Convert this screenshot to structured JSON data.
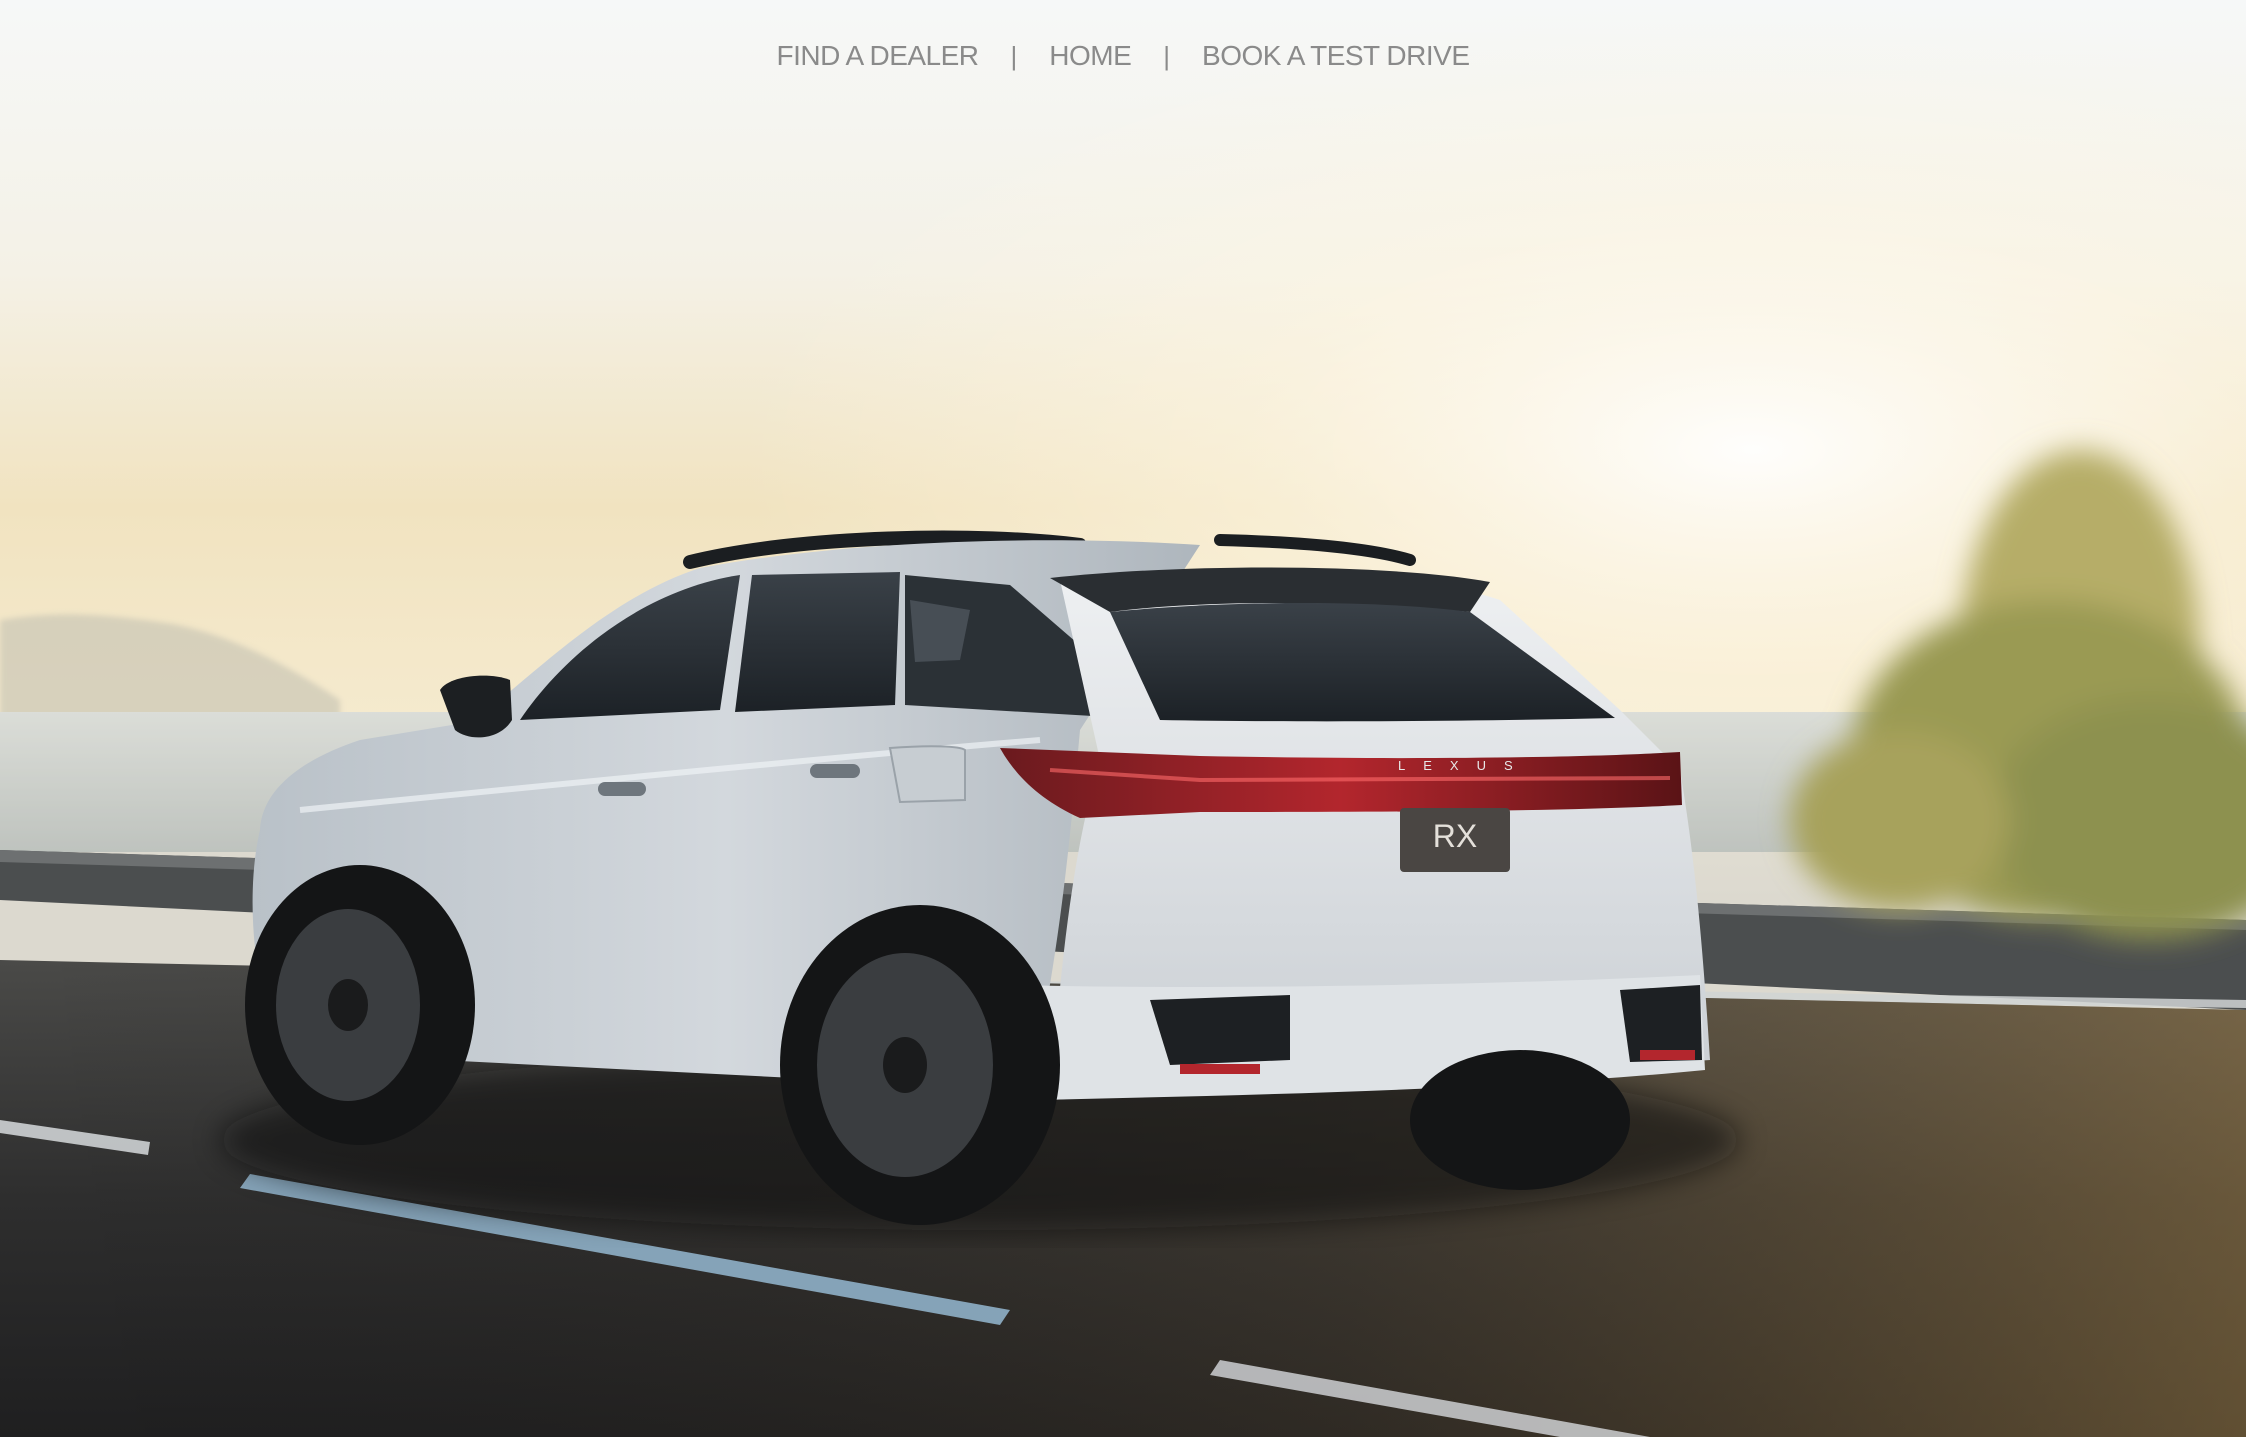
{
  "nav": {
    "links": [
      {
        "label": "FIND A DEALER"
      },
      {
        "label": "HOME"
      },
      {
        "label": "BOOK A TEST DRIVE"
      }
    ],
    "separator": "|"
  },
  "hero": {
    "badge_text": "RX",
    "brand_text": "LEXUS"
  },
  "colors": {
    "nav_text": "#8a8a8a",
    "car_body": "#c9ced3",
    "sky": "#f3f1e8",
    "road": "#2c2c2c"
  }
}
